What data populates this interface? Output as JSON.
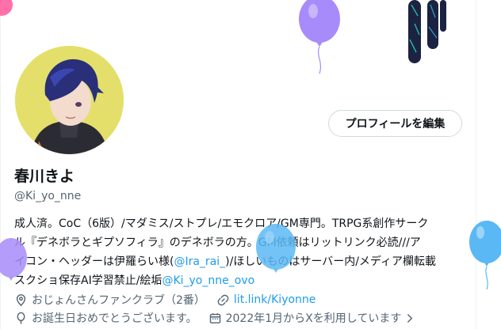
{
  "profile": {
    "display_name": "春川きよ",
    "handle": "@Ki_yo_nne",
    "edit_button_label": "プロフィールを編集"
  },
  "bio": {
    "line1": "成人済。CoC（6版）/マダミス/ストプレ/エモクロア/GM専門。TRPG系創作サーク",
    "line2": "ル『デネボラとギプソフィラ』のデネボラの方。GM依頼はリットリンク必読///ア",
    "line3_before": "イコン・ヘッダーは伊羅らい様(",
    "line3_mention": "@Ira_rai_",
    "line3_after": ")/ほしいものはサーバー内/メディア欄転載",
    "line4_before": "スクショ保存AI学習禁止/絵垢",
    "line4_mention": "@Ki_yo_nne_ovo"
  },
  "meta": {
    "location": "おじょんさんファンクラブ（2番）",
    "website": "lit.link/Kiyonne",
    "birthday": "お誕生日おめでとうございます。",
    "joined": "2022年1月からXを利用しています"
  },
  "colors": {
    "link": "#1d9bf0",
    "secondary_text": "#536471",
    "balloon_purple": "#a78bfa",
    "balloon_blue": "#5ab8f5",
    "balloon_pink": "#ff6fa8",
    "avatar_bg": "#e4df6a"
  },
  "icons": [
    "location-pin-icon",
    "link-icon",
    "balloon-icon",
    "calendar-icon",
    "chevron-right-icon"
  ]
}
